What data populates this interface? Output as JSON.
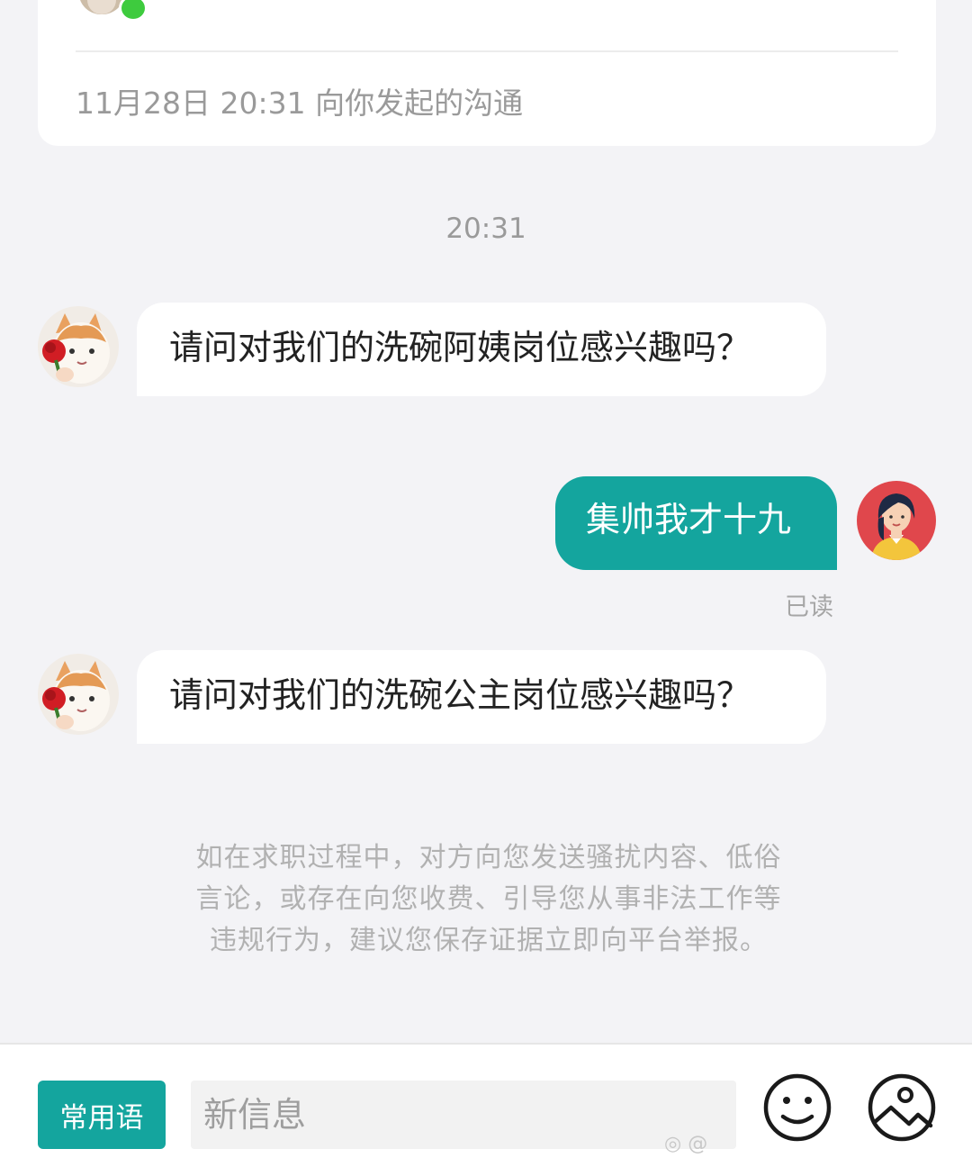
{
  "card": {
    "note": "11月28日  20:31 向你发起的沟通"
  },
  "chat": {
    "time": "20:31",
    "messages": [
      {
        "side": "left",
        "text": "请问对我们的洗碗阿姨岗位感兴趣吗？"
      },
      {
        "side": "right",
        "text": "集帅我才十九",
        "status": "已读"
      },
      {
        "side": "left",
        "text": "请问对我们的洗碗公主岗位感兴趣吗？"
      }
    ]
  },
  "notice": "如在求职过程中，对方向您发送骚扰内容、低俗言论，或存在向您收费、引导您从事非法工作等违规行为，建议您保存证据立即向平台举报。",
  "composer": {
    "phrases_label": "常用语",
    "placeholder": "新信息",
    "emoji_icon": "smiley-face-icon",
    "image_icon": "image-icon"
  },
  "watermark": "@",
  "colors": {
    "accent": "#14a59e",
    "background": "#f3f3f6",
    "online": "#3ecb3e"
  }
}
